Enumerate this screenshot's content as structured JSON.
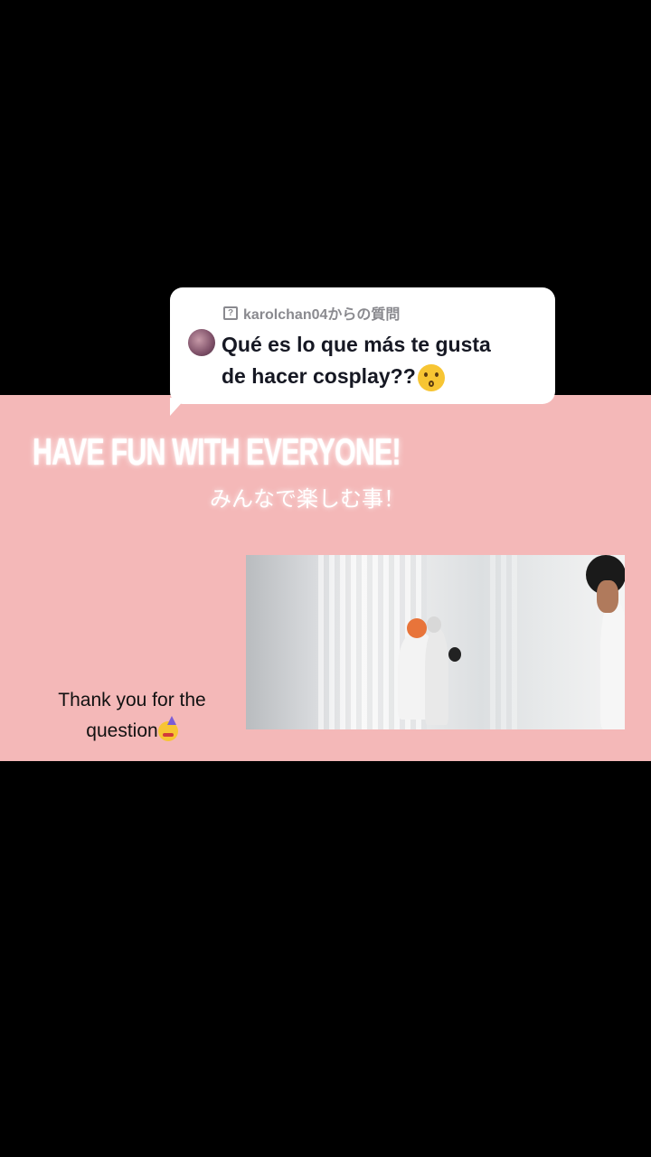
{
  "reply_card": {
    "header": "karolchan04からの質問",
    "question_line1": "Qué es lo que más te gusta",
    "question_line2": "de hacer cosplay??"
  },
  "video_text": {
    "headline": "HAVE FUN WITH EVERYONE!",
    "subtitle": "みんなで楽しむ事！",
    "thanks_line1": "Thank you for the",
    "thanks_line2": "question"
  },
  "colors": {
    "background": "#000000",
    "band": "#f4b8b8",
    "bubble": "#ffffff",
    "text_dark": "#161823",
    "text_gray": "#8a8a8f"
  },
  "icons": {
    "question": "question-mark-box-icon",
    "kiss_emoji": "kissing-face-emoji-icon",
    "party_emoji": "partying-face-emoji-icon"
  }
}
